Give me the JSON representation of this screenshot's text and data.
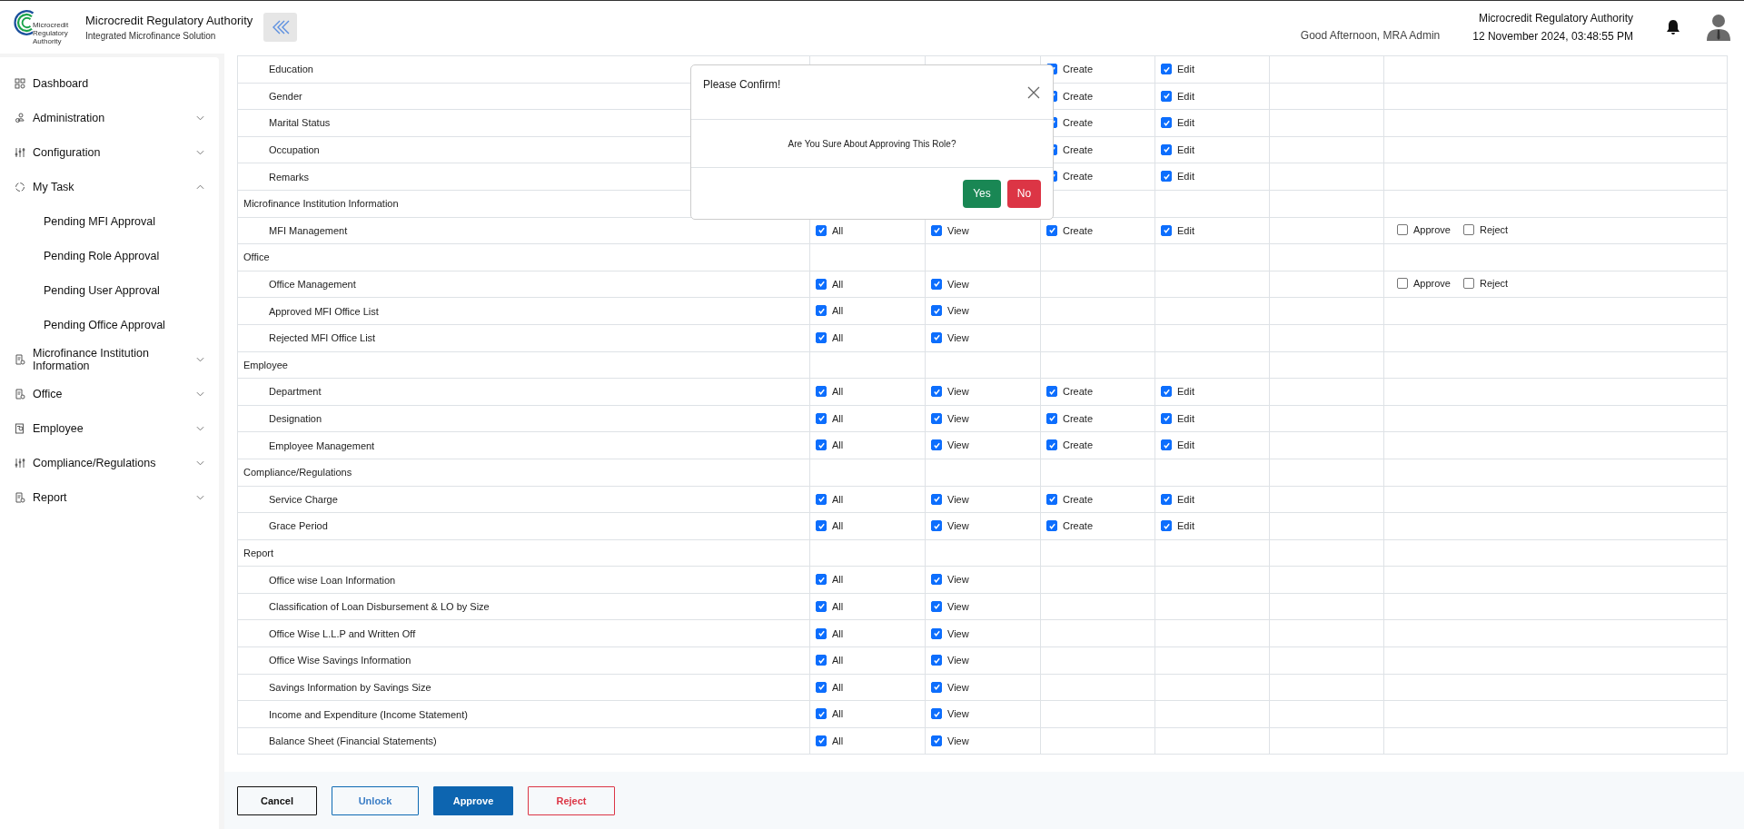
{
  "header": {
    "logo_lines": [
      "Microcredit",
      "Regulatory",
      "Authority"
    ],
    "title": "Microcredit Regulatory Authority",
    "subtitle": "Integrated Microfinance Solution",
    "greeting": "Good Afternoon, MRA Admin",
    "org": "Microcredit Regulatory Authority",
    "datetime": "12 November 2024, 03:48:55 PM"
  },
  "sidebar": {
    "items": [
      {
        "label": "Dashboard",
        "kind": "grid"
      },
      {
        "label": "Administration",
        "kind": "people",
        "expanded": false
      },
      {
        "label": "Configuration",
        "kind": "sliders",
        "expanded": false
      },
      {
        "label": "My Task",
        "kind": "spinner",
        "expanded": true,
        "children": [
          {
            "label": "Pending MFI Approval"
          },
          {
            "label": "Pending Role Approval"
          },
          {
            "label": "Pending User Approval"
          },
          {
            "label": "Pending Office Approval"
          }
        ]
      },
      {
        "label": "Microfinance Institution Information",
        "kind": "document",
        "expanded": false
      },
      {
        "label": "Office",
        "kind": "document",
        "expanded": false
      },
      {
        "label": "Employee",
        "kind": "badge",
        "expanded": false
      },
      {
        "label": "Compliance/Regulations",
        "kind": "sliders",
        "expanded": false
      },
      {
        "label": "Report",
        "kind": "document",
        "expanded": false
      }
    ]
  },
  "table": {
    "rows": [
      {
        "kind": "item",
        "name": "Education",
        "create": {
          "label": "Create",
          "checked": true
        },
        "edit": {
          "label": "Edit",
          "checked": true
        }
      },
      {
        "kind": "item",
        "name": "Gender",
        "create": {
          "label": "Create",
          "checked": true
        },
        "edit": {
          "label": "Edit",
          "checked": true
        }
      },
      {
        "kind": "item",
        "name": "Marital Status",
        "create": {
          "label": "Create",
          "checked": true
        },
        "edit": {
          "label": "Edit",
          "checked": true
        }
      },
      {
        "kind": "item",
        "name": "Occupation",
        "create": {
          "label": "Create",
          "checked": true
        },
        "edit": {
          "label": "Edit",
          "checked": true
        }
      },
      {
        "kind": "item",
        "name": "Remarks",
        "create": {
          "label": "Create",
          "checked": true
        },
        "edit": {
          "label": "Edit",
          "checked": true
        }
      },
      {
        "kind": "section",
        "name": "Microfinance Institution Information"
      },
      {
        "kind": "item",
        "name": "MFI Management",
        "all": {
          "label": "All",
          "checked": true
        },
        "view": {
          "label": "View",
          "checked": true
        },
        "create": {
          "label": "Create",
          "checked": true
        },
        "edit": {
          "label": "Edit",
          "checked": true
        },
        "approve": {
          "label": "Approve",
          "checked": false
        },
        "reject": {
          "label": "Reject",
          "checked": false
        }
      },
      {
        "kind": "section",
        "name": "Office"
      },
      {
        "kind": "item",
        "name": "Office Management",
        "all": {
          "label": "All",
          "checked": true
        },
        "view": {
          "label": "View",
          "checked": true
        },
        "approve": {
          "label": "Approve",
          "checked": false
        },
        "reject": {
          "label": "Reject",
          "checked": false
        }
      },
      {
        "kind": "item",
        "name": "Approved MFI Office List",
        "all": {
          "label": "All",
          "checked": true
        },
        "view": {
          "label": "View",
          "checked": true
        }
      },
      {
        "kind": "item",
        "name": "Rejected MFI Office List",
        "all": {
          "label": "All",
          "checked": true
        },
        "view": {
          "label": "View",
          "checked": true
        }
      },
      {
        "kind": "section",
        "name": "Employee"
      },
      {
        "kind": "item",
        "name": "Department",
        "all": {
          "label": "All",
          "checked": true
        },
        "view": {
          "label": "View",
          "checked": true
        },
        "create": {
          "label": "Create",
          "checked": true
        },
        "edit": {
          "label": "Edit",
          "checked": true
        }
      },
      {
        "kind": "item",
        "name": "Designation",
        "all": {
          "label": "All",
          "checked": true
        },
        "view": {
          "label": "View",
          "checked": true
        },
        "create": {
          "label": "Create",
          "checked": true
        },
        "edit": {
          "label": "Edit",
          "checked": true
        }
      },
      {
        "kind": "item",
        "name": "Employee Management",
        "all": {
          "label": "All",
          "checked": true
        },
        "view": {
          "label": "View",
          "checked": true
        },
        "create": {
          "label": "Create",
          "checked": true
        },
        "edit": {
          "label": "Edit",
          "checked": true
        }
      },
      {
        "kind": "section",
        "name": "Compliance/Regulations"
      },
      {
        "kind": "item",
        "name": "Service Charge",
        "all": {
          "label": "All",
          "checked": true
        },
        "view": {
          "label": "View",
          "checked": true
        },
        "create": {
          "label": "Create",
          "checked": true
        },
        "edit": {
          "label": "Edit",
          "checked": true
        }
      },
      {
        "kind": "item",
        "name": "Grace Period",
        "all": {
          "label": "All",
          "checked": true
        },
        "view": {
          "label": "View",
          "checked": true
        },
        "create": {
          "label": "Create",
          "checked": true
        },
        "edit": {
          "label": "Edit",
          "checked": true
        }
      },
      {
        "kind": "section",
        "name": "Report"
      },
      {
        "kind": "item",
        "name": "Office wise Loan Information",
        "all": {
          "label": "All",
          "checked": true
        },
        "view": {
          "label": "View",
          "checked": true
        }
      },
      {
        "kind": "item",
        "name": "Classification of Loan Disbursement & LO by Size",
        "all": {
          "label": "All",
          "checked": true
        },
        "view": {
          "label": "View",
          "checked": true
        }
      },
      {
        "kind": "item",
        "name": "Office Wise L.L.P and Written Off",
        "all": {
          "label": "All",
          "checked": true
        },
        "view": {
          "label": "View",
          "checked": true
        }
      },
      {
        "kind": "item",
        "name": "Office Wise Savings Information",
        "all": {
          "label": "All",
          "checked": true
        },
        "view": {
          "label": "View",
          "checked": true
        }
      },
      {
        "kind": "item",
        "name": "Savings Information by Savings Size",
        "all": {
          "label": "All",
          "checked": true
        },
        "view": {
          "label": "View",
          "checked": true
        }
      },
      {
        "kind": "item",
        "name": "Income and Expenditure (Income Statement)",
        "all": {
          "label": "All",
          "checked": true
        },
        "view": {
          "label": "View",
          "checked": true
        }
      },
      {
        "kind": "item",
        "name": "Balance Sheet (Financial Statements)",
        "all": {
          "label": "All",
          "checked": true
        },
        "view": {
          "label": "View",
          "checked": true
        }
      }
    ]
  },
  "actions": [
    {
      "label": "Cancel",
      "kind": "outline-dark"
    },
    {
      "label": "Unlock",
      "kind": "outline-primary"
    },
    {
      "label": "Approve",
      "kind": "primary"
    },
    {
      "label": "Reject",
      "kind": "outline-danger"
    }
  ],
  "dialog": {
    "title": "Please Confirm!",
    "message": "Are You Sure About Approving This Role?",
    "buttons": [
      {
        "label": "Yes",
        "kind": "success"
      },
      {
        "label": "No",
        "kind": "danger"
      }
    ]
  }
}
